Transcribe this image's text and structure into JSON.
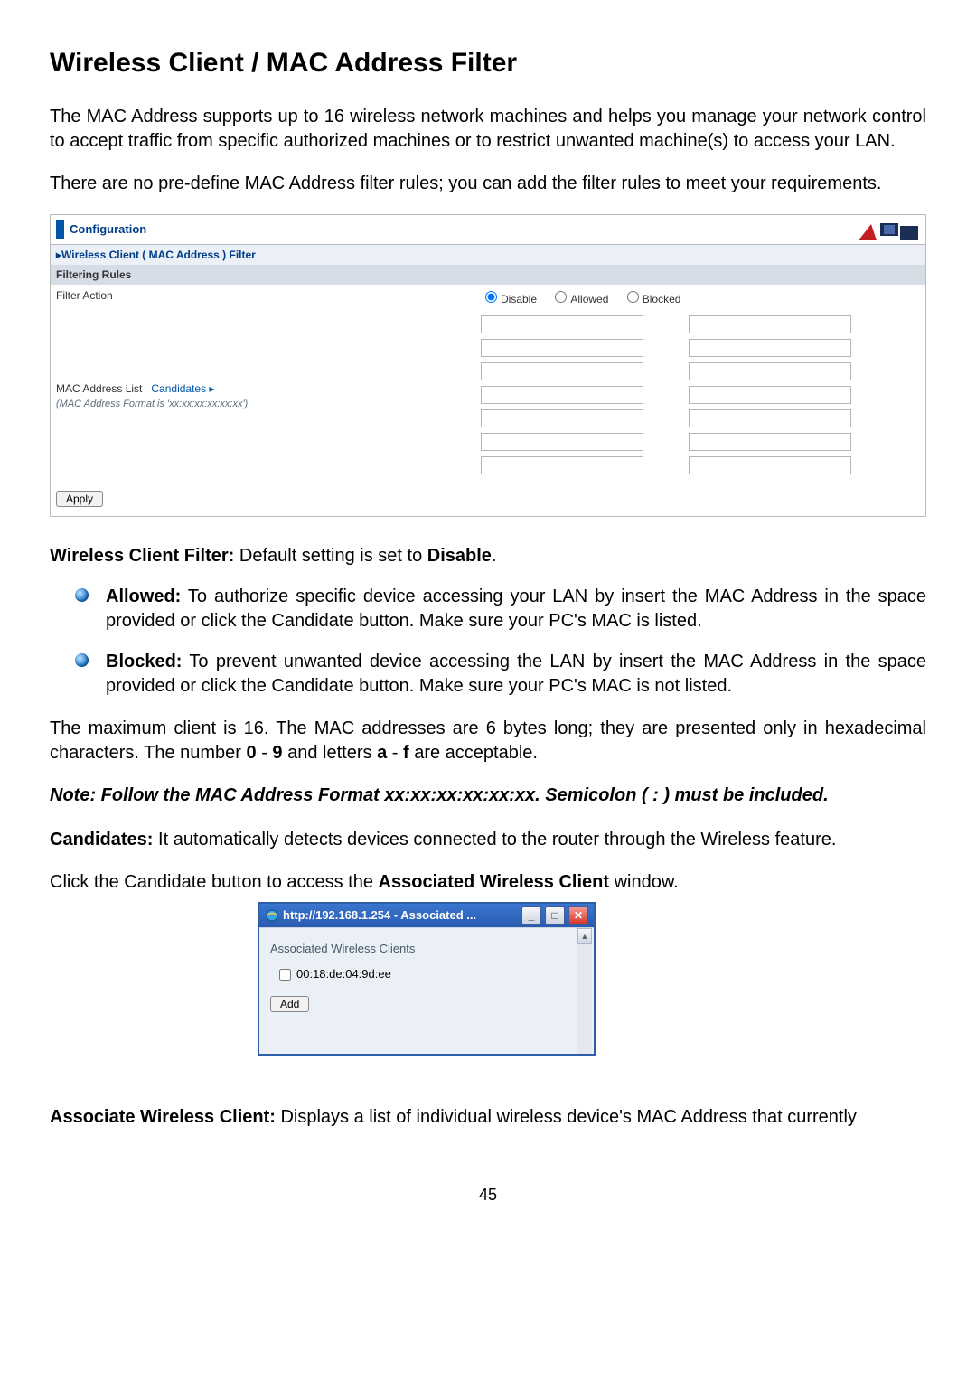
{
  "heading": "Wireless Client / MAC Address Filter",
  "intro1": "The MAC Address supports up to 16 wireless network machines and helps you manage your network control to accept traffic from specific authorized machines or to restrict unwanted machine(s) to access your LAN.",
  "intro2": "There are no pre-define MAC Address filter rules; you can add the filter rules to meet your requirements.",
  "panel": {
    "title": "Configuration",
    "section": "▸Wireless Client ( MAC Address ) Filter",
    "rules_header": "Filtering Rules",
    "filter_action_label": "Filter Action",
    "radios": {
      "disable": "Disable",
      "allowed": "Allowed",
      "blocked": "Blocked"
    },
    "mac_list_label": "MAC Address List",
    "candidates": "Candidates ▸",
    "mac_format_hint": "(MAC Address Format is 'xx:xx:xx:xx:xx:xx')",
    "apply": "Apply"
  },
  "default_setting": {
    "label": "Wireless Client Filter:",
    "text": " Default setting is set to ",
    "value": "Disable"
  },
  "bullets": {
    "allowed": {
      "label": "Allowed:",
      "text": " To authorize specific device accessing your LAN by insert the MAC Address in the space provided or click the Candidate button.  Make sure your PC's MAC is listed."
    },
    "blocked": {
      "label": "Blocked:",
      "text": " To prevent unwanted device accessing the LAN by insert the MAC Address in the space provided or click the Candidate button. Make sure your PC's MAC is not listed."
    }
  },
  "max_client_1": "The maximum client is 16.  The MAC addresses are 6 bytes long; they are presented only in hexadecimal characters.  The number ",
  "max_client_bold1": "0",
  "max_client_2": " - ",
  "max_client_bold2": "9",
  "max_client_3": " and letters ",
  "max_client_bold3": "a",
  "max_client_4": " - ",
  "max_client_bold4": "f",
  "max_client_5": " are acceptable.",
  "note": "Note:  Follow the MAC Address Format xx:xx:xx:xx:xx:xx.  Semicolon ( : ) must be included.",
  "candidates_label": "Candidates:",
  "candidates_text": " It automatically detects devices connected to the router through the Wireless feature.",
  "click_cand_1": "Click the Candidate button to access the ",
  "click_cand_bold": "Associated Wireless Client",
  "click_cand_2": " window.",
  "popup": {
    "title": "http://192.168.1.254 - Associated ...",
    "assoc_title": "Associated Wireless Clients",
    "client_mac": "00:18:de:04:9d:ee",
    "add": "Add"
  },
  "assoc_label": "Associate Wireless Client:",
  "assoc_text": " Displays a list of individual wireless device's MAC Address that currently",
  "page_number": "45"
}
